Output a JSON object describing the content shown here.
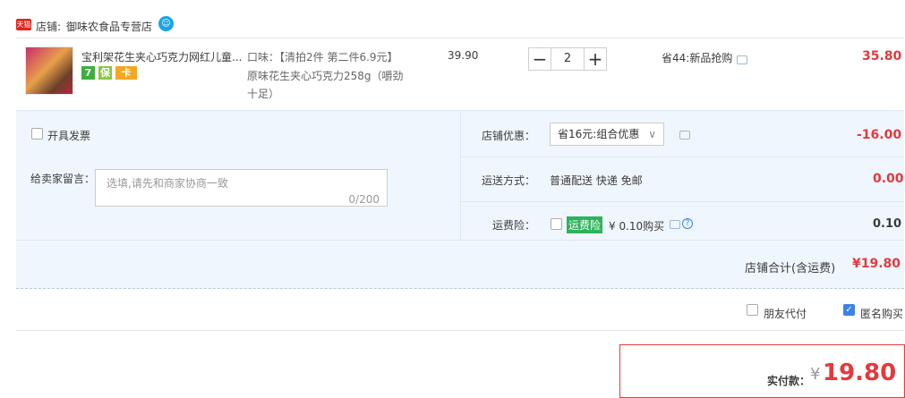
{
  "shop": {
    "tmall_badge": "天猫",
    "label": "店铺:",
    "name": "御味农食品专营店"
  },
  "item": {
    "title": "宝利架花生夹心巧克力网红儿童...",
    "badges": [
      "7",
      "保",
      "卡"
    ],
    "attr_line1": "口味：【清拍2件 第二件6.9元】",
    "attr_line2": "原味花生夹心巧克力258g（嚼劲",
    "attr_line3": "十足）",
    "unit_price": "39.90",
    "quantity": "2",
    "minus": "−",
    "plus": "+",
    "promo": "省44:新品抢购",
    "subtotal": "35.80"
  },
  "invoice": {
    "label": "开具发票"
  },
  "message": {
    "label": "给卖家留言：",
    "placeholder": "选填,请先和商家协商一致",
    "counter": "0/200"
  },
  "discount": {
    "label": "店铺优惠：",
    "selected": "省16元:组合优惠",
    "amount": "-16.00"
  },
  "shipping": {
    "label": "运送方式：",
    "value": "普通配送 快递 免邮",
    "amount": "0.00"
  },
  "insurance": {
    "label": "运费险：",
    "tag": "运费险",
    "price": "¥ 0.10购买",
    "amount": "0.10"
  },
  "shop_total": {
    "label": "店铺合计(含运费)",
    "amount": "¥19.80"
  },
  "options": {
    "friend_pay": "朋友代付",
    "anonymous": "匿名购买"
  },
  "payment": {
    "label": "实付款：",
    "currency": "¥",
    "amount": "19.80"
  }
}
